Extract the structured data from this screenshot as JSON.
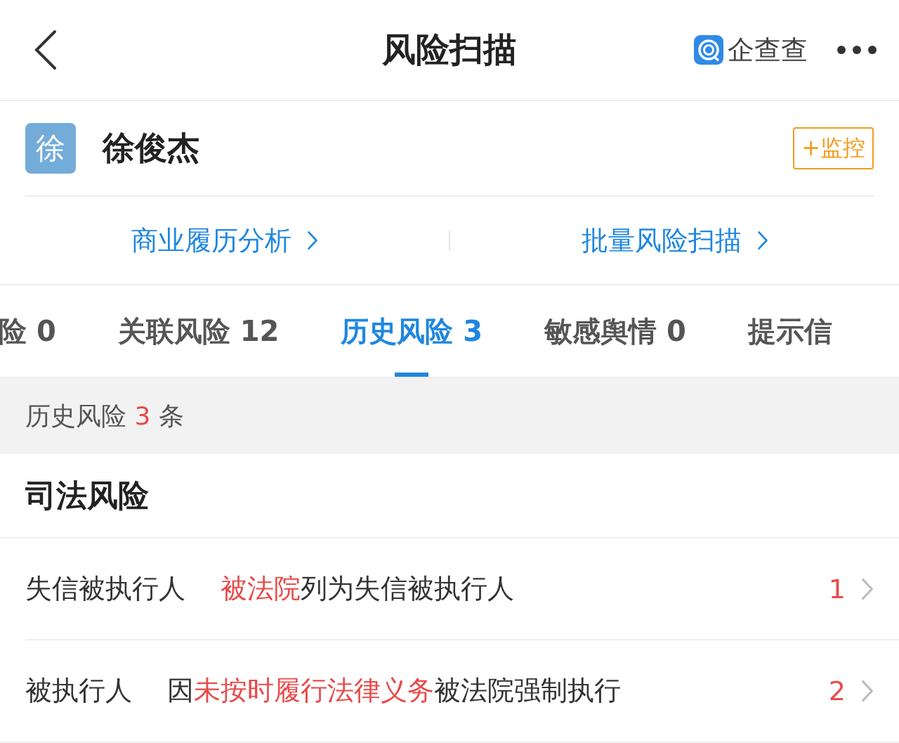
{
  "header": {
    "title": "风险扫描",
    "brand": "企查查"
  },
  "profile": {
    "avatar": "徐",
    "name": "徐俊杰",
    "monitor_button": "+监控"
  },
  "links": [
    {
      "label": "商业履历分析"
    },
    {
      "label": "批量风险扫描"
    }
  ],
  "tabs": [
    {
      "label": "险 0",
      "selected": false
    },
    {
      "label": "关联风险 12",
      "selected": false
    },
    {
      "label": "历史风险 3",
      "selected": true
    },
    {
      "label": "敏感舆情 0",
      "selected": false
    },
    {
      "label": "提示信",
      "selected": false
    }
  ],
  "summary": {
    "prefix": "历史风险",
    "count": "3",
    "suffix": "条"
  },
  "section": {
    "title": "司法风险"
  },
  "rows": [
    {
      "label": "失信被执行人",
      "description": [
        {
          "text": "被法院",
          "highlight": true
        },
        {
          "text": "列为失信被执行人",
          "highlight": false
        }
      ],
      "count": "1"
    },
    {
      "label": "被执行人",
      "description": [
        {
          "text": "因",
          "highlight": false
        },
        {
          "text": "未按时履行法律义务",
          "highlight": true
        },
        {
          "text": "被法院强制执行",
          "highlight": false
        }
      ],
      "count": "2"
    }
  ]
}
